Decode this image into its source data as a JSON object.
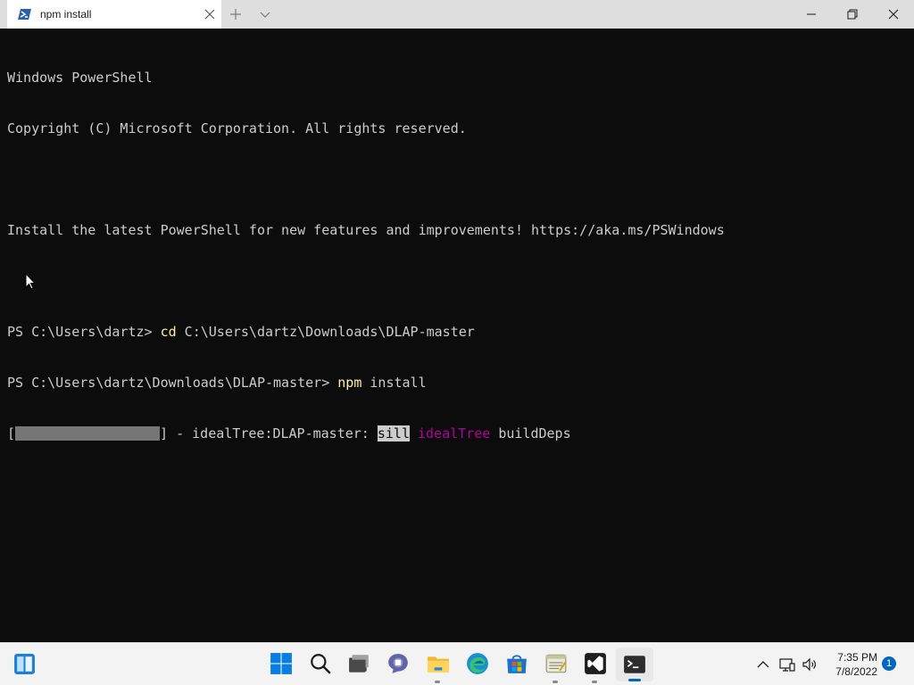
{
  "tab": {
    "title": "npm install"
  },
  "terminal": {
    "lines": [
      {
        "text": "Windows PowerShell"
      },
      {
        "text": "Copyright (C) Microsoft Corporation. All rights reserved."
      },
      {
        "text": ""
      },
      {
        "text": "Install the latest PowerShell for new features and improvements! https://aka.ms/PSWindows"
      },
      {
        "text": ""
      },
      {
        "prompt": "PS C:\\Users\\dartz> ",
        "cmd": "cd",
        "args": " C:\\Users\\dartz\\Downloads\\DLAP-master"
      },
      {
        "prompt": "PS C:\\Users\\dartz\\Downloads\\DLAP-master> ",
        "cmd": "npm",
        "args": " install"
      }
    ],
    "progress": {
      "open": "[",
      "close": "]",
      "spinner": " - ",
      "stage": "idealTree:DLAP-master: ",
      "level": "sill",
      "module": "idealTree",
      "message": "buildDeps"
    },
    "colors": {
      "background": "#0c0c0c",
      "foreground": "#cccccc",
      "command": "#f9f1a5",
      "magenta": "#b4009e"
    }
  },
  "taskbar": {
    "apps": [
      {
        "name": "start",
        "icon": "windows-logo-icon"
      },
      {
        "name": "search",
        "icon": "search-icon"
      },
      {
        "name": "task-view",
        "icon": "task-view-icon"
      },
      {
        "name": "teams-chat",
        "icon": "teams-chat-icon"
      },
      {
        "name": "file-explorer",
        "icon": "folder-icon"
      },
      {
        "name": "edge",
        "icon": "edge-icon"
      },
      {
        "name": "store",
        "icon": "store-icon"
      },
      {
        "name": "notepad",
        "icon": "notepad-icon"
      },
      {
        "name": "visual-studio",
        "icon": "visual-studio-icon"
      },
      {
        "name": "terminal",
        "icon": "terminal-icon"
      }
    ],
    "clock": {
      "time": "7:35 PM",
      "date": "7/8/2022"
    },
    "notifications": "1"
  }
}
